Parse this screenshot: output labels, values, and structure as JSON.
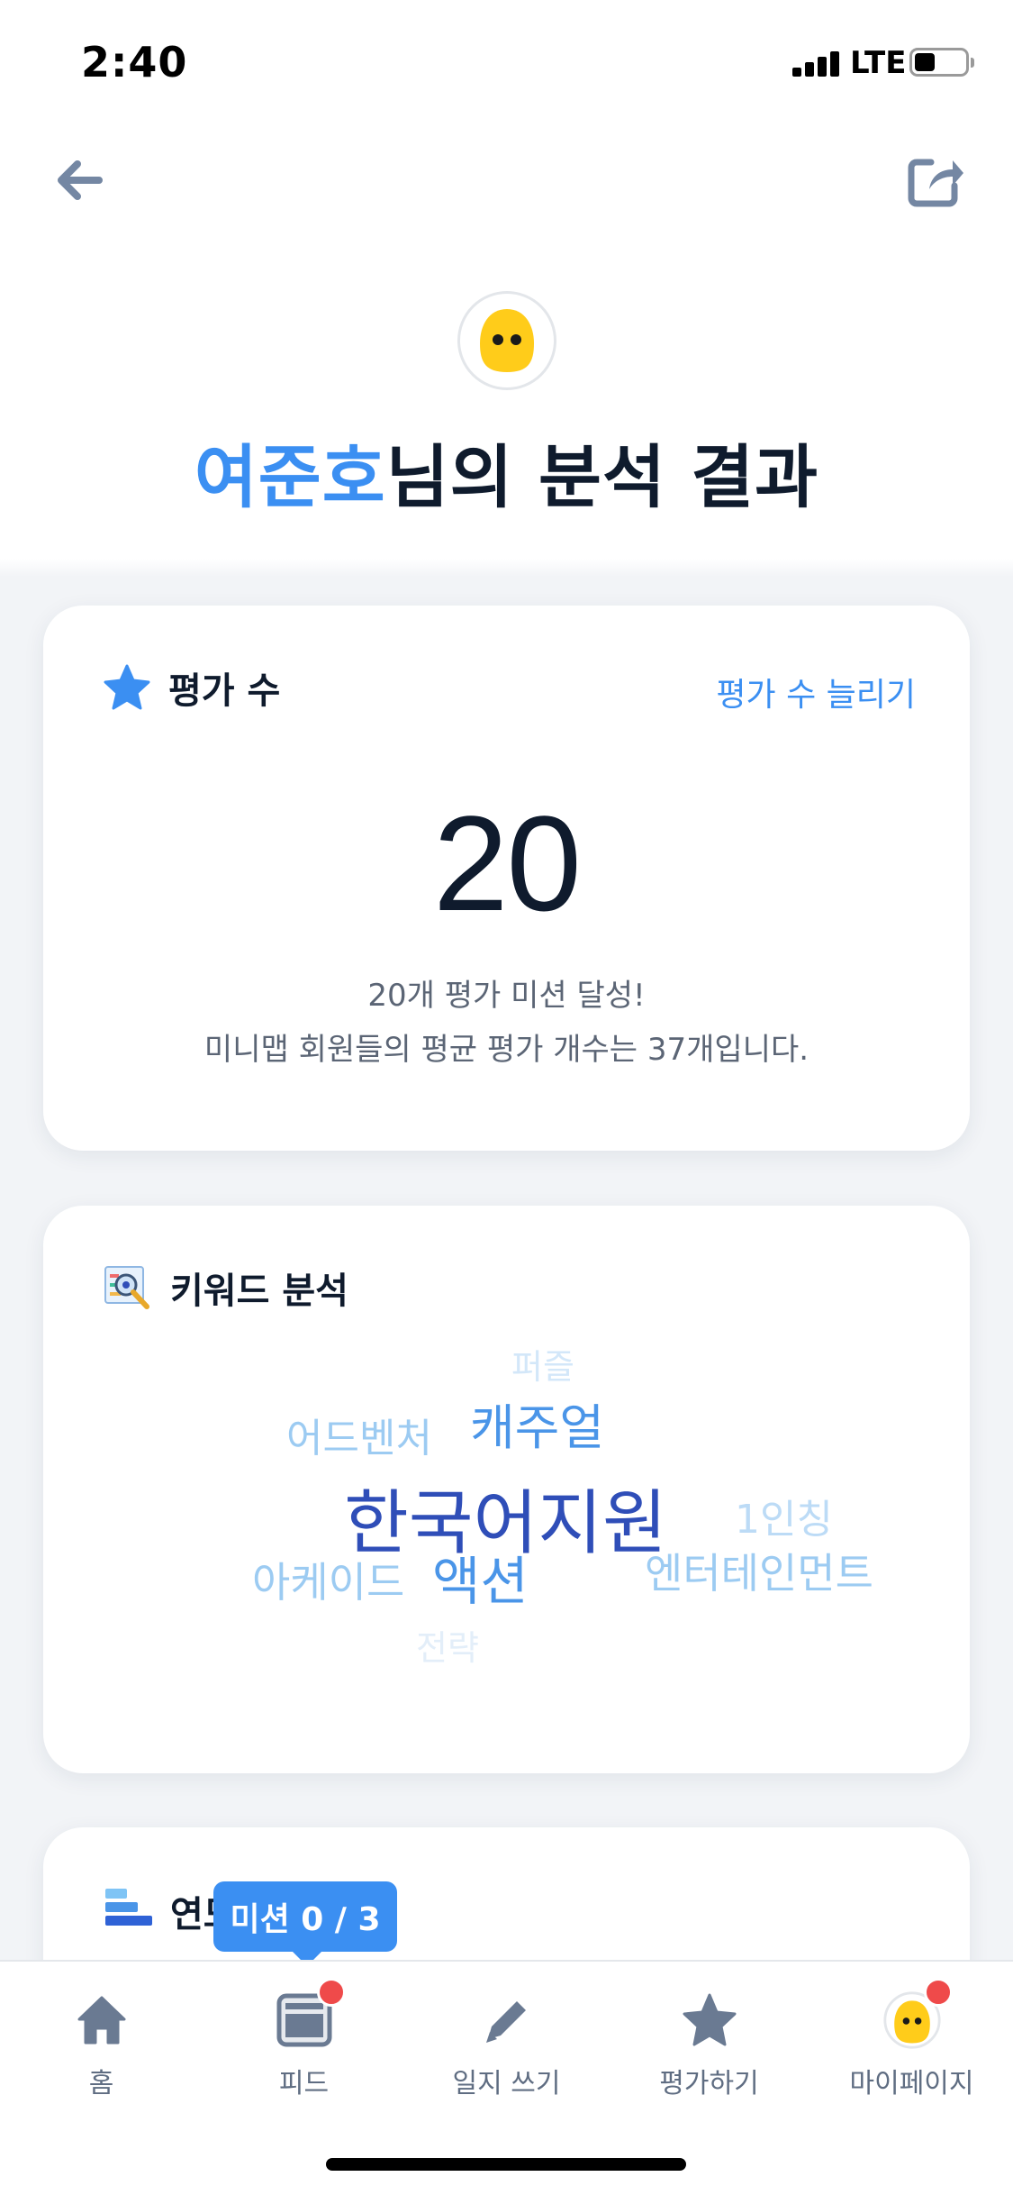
{
  "status_bar": {
    "time": "2:40",
    "network": "LTE"
  },
  "header": {
    "user_name": "여준호",
    "title_suffix": "님의 분석 결과"
  },
  "rating_card": {
    "title": "평가 수",
    "link_label": "평가 수 늘리기",
    "count": "20",
    "message_line1": "20개 평가 미션 달성!",
    "message_line2": "미니맵 회원들의 평균 평가 개수는 37개입니다."
  },
  "keyword_card": {
    "title": "키워드 분석",
    "keywords": [
      "퍼즐",
      "캐주얼",
      "어드벤처",
      "한국어지원",
      "1인칭",
      "아케이드",
      "액션",
      "엔터테인먼트",
      "전략"
    ]
  },
  "year_card": {
    "title_visible": "연도"
  },
  "mission_tooltip": {
    "label": "미션 0 / 3"
  },
  "tab_bar": {
    "tabs": [
      {
        "label": "홈"
      },
      {
        "label": "피드"
      },
      {
        "label": "일지 쓰기"
      },
      {
        "label": "평가하기"
      },
      {
        "label": "마이페이지"
      }
    ]
  },
  "colors": {
    "accent": "#3b8ff2",
    "keyword_dark": "#2f4eb8",
    "keyword_mid": "#4a95e8",
    "keyword_light": "#9ccbf2",
    "keyword_faint": "#d3e7f9",
    "badge_red": "#ef4a4a",
    "tab_icon": "#6a7a92"
  },
  "icons": [
    "back-arrow-icon",
    "share-icon",
    "star-icon",
    "keyword-search-icon",
    "bar-chart-icon",
    "home-icon",
    "feed-icon",
    "pencil-icon",
    "star-icon",
    "avatar-icon"
  ]
}
